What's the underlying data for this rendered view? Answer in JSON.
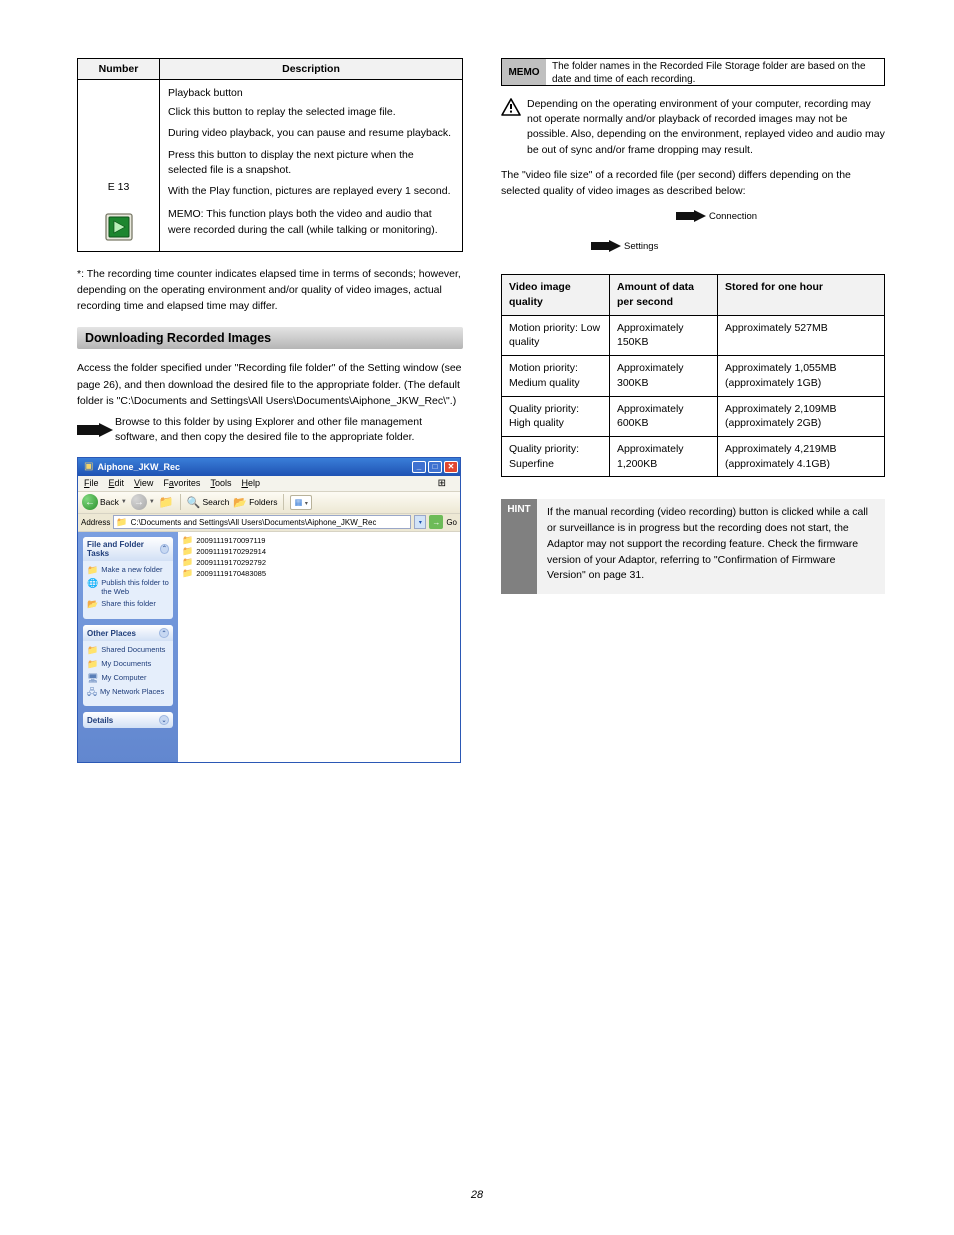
{
  "leftTable": {
    "headers": [
      "Number",
      "Description"
    ],
    "numberCell": "E 13",
    "desc": [
      "Playback button",
      "Click this button to replay the selected image file.",
      "During video playback, you can pause and resume playback.",
      "Press this button to display the next picture when the selected file is a snapshot.",
      "With the Play function, pictures are replayed every 1 second.",
      "MEMO: This function plays both the video and audio that were recorded during the call (while talking or monitoring)."
    ]
  },
  "leftNote": "*: The recording time counter indicates elapsed time in terms of seconds; however, depending on the operating environment and/or quality of video images, actual recording time and elapsed time may differ.",
  "leftHeading": "Downloading Recorded Images",
  "leftPara": "Access the folder specified under \"Recording file folder\" of the Setting window (see page 26), and then download the desired file to the appropriate folder.  (The default folder is \"C:\\Documents and Settings\\All Users\\Documents\\Aiphone_JKW_Rec\\\".)",
  "leftArrow": "Browse to this folder by using Explorer and other file management software, and then copy the desired file to the appropriate folder.",
  "explorer": {
    "title": "Aiphone_JKW_Rec",
    "menus": [
      "File",
      "Edit",
      "View",
      "Favorites",
      "Tools",
      "Help"
    ],
    "back": "Back",
    "search": "Search",
    "folders": "Folders",
    "addressLabel": "Address",
    "addressPath": "C:\\Documents and Settings\\All Users\\Documents\\Aiphone_JKW_Rec",
    "panels": {
      "tasks": {
        "title": "File and Folder Tasks",
        "items": [
          "Make a new folder",
          "Publish this folder to the Web",
          "Share this folder"
        ]
      },
      "places": {
        "title": "Other Places",
        "items": [
          "Shared Documents",
          "My Documents",
          "My Computer",
          "My Network Places"
        ]
      },
      "details": {
        "title": "Details"
      }
    },
    "files": [
      "20091119170097119",
      "20091119170292914",
      "20091119170292792",
      "20091119170483085"
    ]
  },
  "memo": {
    "label": "MEMO",
    "text": "The folder names in the Recorded File Storage folder are based on the date and time of each recording."
  },
  "warning": "Depending on the operating environment of your computer, recording may not operate normally and/or playback of recorded images may not be possible.  Also, depending on the environment, replayed video and audio may be out of sync and/or frame dropping may result.",
  "rightPara": "The \"video file size\" of a recorded file (per second) differs depending on the selected quality of video images as described below:",
  "miniSteps": {
    "s1": "Settings",
    "s2": "Connection"
  },
  "videoTable": {
    "headers": [
      "Video image quality",
      "Amount of data per second",
      "Stored for one hour"
    ],
    "rows": [
      [
        "Motion priority: Low quality",
        "Approximately 150KB",
        "Approximately 527MB"
      ],
      [
        "Motion priority: Medium quality",
        "Approximately 300KB",
        "Approximately 1,055MB (approximately 1GB)"
      ],
      [
        "Quality priority: High quality",
        "Approximately 600KB",
        "Approximately 2,109MB (approximately 2GB)"
      ],
      [
        "Quality priority: Superfine",
        "Approximately 1,200KB",
        "Approximately 4,219MB (approximately 4.1GB)"
      ]
    ]
  },
  "hint": {
    "label": "HINT",
    "text": "If the manual recording (video recording) button is clicked while a call or surveillance is in progress but the recording does not start, the Adaptor may not support the recording feature.  Check the firmware version of your Adaptor, referring to \"Confirmation of Firmware Version\" on page 31."
  },
  "pageNumber": "28"
}
